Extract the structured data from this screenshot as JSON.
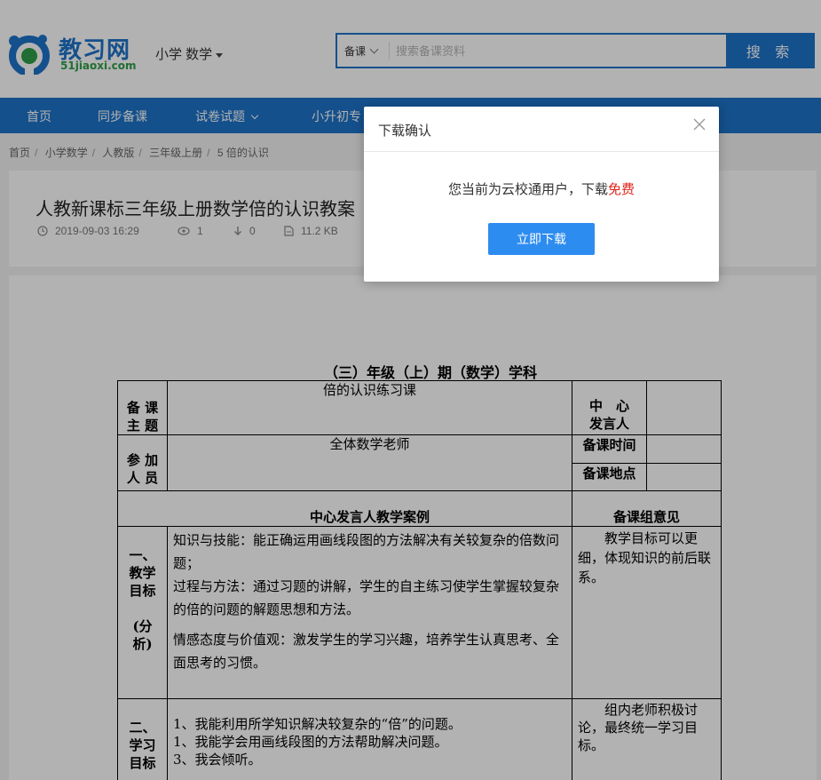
{
  "header": {
    "logo_cn": "教习网",
    "logo_en": "51jiaoxi.com",
    "subject": "小学 数学",
    "search": {
      "type": "备课",
      "placeholder": "搜索备课资料",
      "button": "搜 索"
    }
  },
  "nav": {
    "items": [
      "首页",
      "同步备课",
      "试卷试题",
      "小升初专"
    ]
  },
  "breadcrumb": [
    "首页",
    "小学数学",
    "人教版",
    "三年级上册",
    "5 倍的认识"
  ],
  "doc_card": {
    "title": "人教新课标三年级上册数学倍的认识教案",
    "date": "2019-09-03 16:29",
    "views": "1",
    "downloads": "0",
    "size": "11.2 KB"
  },
  "document": {
    "heading": "（三）年级（上）期（数学）学科",
    "row1": {
      "label": "备 课\n主 题",
      "value": "倍的认识练习课",
      "side_label": "中　心\n发言人"
    },
    "row2": {
      "label": "参 加\n人 员",
      "value": "全体数学老师",
      "side_label_1": "备课时间",
      "side_label_2": "备课地点"
    },
    "section_header": {
      "left": "中心发言人教学案例",
      "right": "备课组意见"
    },
    "row3": {
      "label": "一、\n教学\n目标\n\n(分\n析)",
      "lines": [
        "知识与技能：能正确运用画线段图的方法解决有关较复杂的倍数问题；",
        "过程与方法：通过习题的讲解，学生的自主练习使学生掌握较复杂的倍的问题的解题思想和方法。",
        "情感态度与价值观：激发学生的学习兴趣，培养学生认真思考、全面思考的习惯。"
      ],
      "opinion": "教学目标可以更细，体现知识的前后联系。"
    },
    "row4": {
      "label": "二、\n学习\n目标",
      "lines": [
        "1、我能利用所学知识解决较复杂的“倍”的问题。",
        "1、我能学会用画线段图的方法帮助解决问题。",
        "3、我会倾听。"
      ],
      "opinion": "组内老师积极讨论，最终统一学习目标。"
    }
  },
  "modal": {
    "title": "下载确认",
    "message": "您当前为云校通用户，下载",
    "message_highlight": "免费",
    "button": "立即下载"
  },
  "colors": {
    "brand_blue": "#1d73c9",
    "button_blue": "#2d8cf0",
    "free_red": "#e1251b"
  }
}
